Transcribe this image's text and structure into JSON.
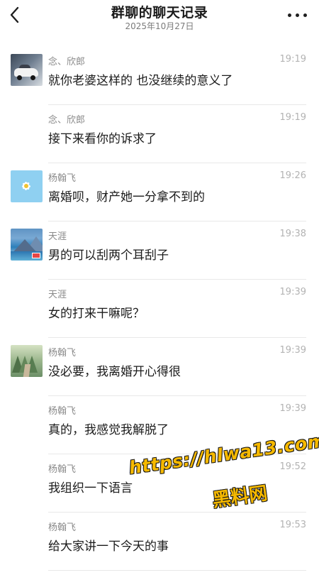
{
  "header": {
    "back_icon": "chevron-left-icon",
    "title": "群聊的聊天记录",
    "date": "2025年10月27日",
    "more_icon": "more-horizontal-icon"
  },
  "messages": [
    {
      "sender": "念、欣郎",
      "time": "19:19",
      "text": "就你老婆这样的 也没继续的意义了",
      "avatar": "car"
    },
    {
      "sender": "念、欣郎",
      "time": "19:19",
      "text": "接下来看你的诉求了",
      "avatar": ""
    },
    {
      "sender": "杨翰飞",
      "time": "19:26",
      "text": "离婚呗，财产她一分拿不到的",
      "avatar": "flower"
    },
    {
      "sender": "天涯",
      "time": "19:38",
      "text": "男的可以刮两个耳刮子",
      "avatar": "scenery"
    },
    {
      "sender": "天涯",
      "time": "19:39",
      "text": "女的打来干嘛呢？",
      "avatar": ""
    },
    {
      "sender": "杨翰飞",
      "time": "19:39",
      "text": "没必要，我离婚开心得很",
      "avatar": "forest"
    },
    {
      "sender": "杨翰飞",
      "time": "19:39",
      "text": "真的，我感觉我解脱了",
      "avatar": ""
    },
    {
      "sender": "杨翰飞",
      "time": "19:52",
      "text": "我组织一下语言",
      "avatar": ""
    },
    {
      "sender": "杨翰飞",
      "time": "19:53",
      "text": "给大家讲一下今天的事",
      "avatar": ""
    }
  ],
  "watermark": {
    "url": "https://hlwa13.com",
    "name": "黑料网"
  }
}
